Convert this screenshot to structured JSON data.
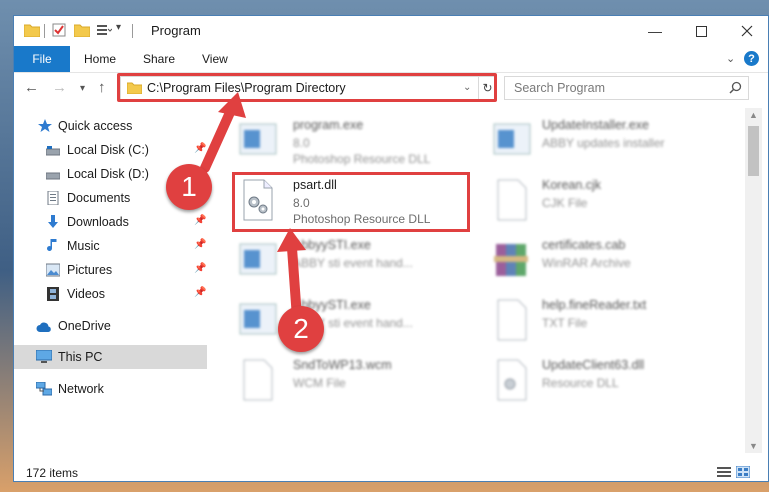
{
  "window": {
    "title": "Program",
    "controls": [
      "minimize",
      "maximize",
      "close"
    ]
  },
  "ribbon": {
    "tabs": [
      "File",
      "Home",
      "Share",
      "View"
    ]
  },
  "address_bar": {
    "path": "C:\\Program Files\\Program Directory"
  },
  "search": {
    "placeholder": "Search Program"
  },
  "sidebar": {
    "items": [
      {
        "label": "Quick access",
        "icon": "star-icon"
      },
      {
        "label": "Local Disk (C:)",
        "icon": "drive-icon"
      },
      {
        "label": "Local Disk (D:)",
        "icon": "drive-icon"
      },
      {
        "label": "Documents",
        "icon": "document-icon"
      },
      {
        "label": "Downloads",
        "icon": "download-arrow-icon"
      },
      {
        "label": "Music",
        "icon": "music-note-icon"
      },
      {
        "label": "Pictures",
        "icon": "pictures-icon"
      },
      {
        "label": "Videos",
        "icon": "film-icon"
      },
      {
        "label": "OneDrive",
        "icon": "cloud-icon"
      },
      {
        "label": "This PC",
        "icon": "monitor-icon"
      },
      {
        "label": "Network",
        "icon": "network-icon"
      }
    ]
  },
  "files": [
    {
      "name": "program.exe",
      "sub1": "8.0",
      "sub2": "Photoshop Resource DLL"
    },
    {
      "name": "UpdateInstaller.exe",
      "sub1": "ABBY updates installer",
      "sub2": ""
    },
    {
      "name": "psart.dll",
      "sub1": "8.0",
      "sub2": "Photoshop Resource DLL"
    },
    {
      "name": "Korean.cjk",
      "sub1": "CJK File",
      "sub2": ""
    },
    {
      "name": "AbbyySTI.exe",
      "sub1": "ABBY sti event hand...",
      "sub2": ""
    },
    {
      "name": "certificates.cab",
      "sub1": "WinRAR Archive",
      "sub2": ""
    },
    {
      "name": "AbbyySTI.exe",
      "sub1": "ABBY sti event hand...",
      "sub2": ""
    },
    {
      "name": "help.fineReader.txt",
      "sub1": "TXT File",
      "sub2": ""
    },
    {
      "name": "SndToWP13.wcm",
      "sub1": "WCM File",
      "sub2": ""
    },
    {
      "name": "UpdateClient63.dll",
      "sub1": "Resource DLL",
      "sub2": ""
    }
  ],
  "status": {
    "item_count": "172 items"
  },
  "annotations": {
    "step1": "1",
    "step2": "2",
    "highlight_color": "#e04040"
  }
}
